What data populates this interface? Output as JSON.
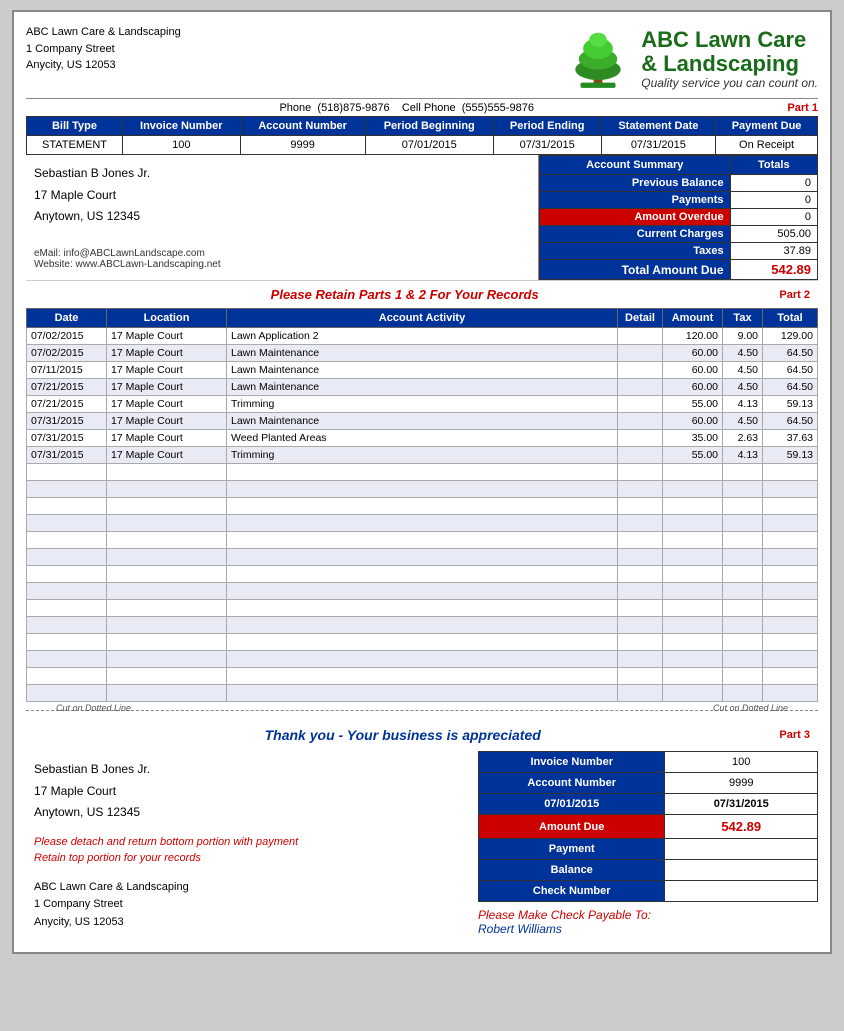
{
  "company": {
    "name_line1": "ABC Lawn Care",
    "name_line2": "& Landscaping",
    "tagline": "Quality service you can count on.",
    "address_line1": "ABC Lawn Care & Landscaping",
    "address_line2": "1 Company Street",
    "address_line3": "Anycity, US  12053"
  },
  "contact": {
    "phone_label": "Phone",
    "phone": "(518)875-9876",
    "cell_label": "Cell Phone",
    "cell": "(555)555-9876"
  },
  "part1_label": "Part 1",
  "billing_header": {
    "bill_type": "Bill Type",
    "invoice_number": "Invoice Number",
    "account_number": "Account Number",
    "period_beginning": "Period Beginning",
    "period_ending": "Period Ending",
    "statement_date": "Statement Date",
    "payment_due": "Payment Due"
  },
  "billing_data": {
    "bill_type": "STATEMENT",
    "invoice_number": "100",
    "account_number": "9999",
    "period_beginning": "07/01/2015",
    "period_ending": "07/31/2015",
    "statement_date": "07/31/2015",
    "payment_due": "On Receipt"
  },
  "customer": {
    "name": "Sebastian B Jones Jr.",
    "address1": "17 Maple Court",
    "address2": "Anytown, US  12345"
  },
  "account_summary": {
    "title": "Account Summary",
    "totals": "Totals",
    "previous_balance": "Previous Balance",
    "payments": "Payments",
    "amount_overdue": "Amount Overdue",
    "current_charges": "Current Charges",
    "taxes": "Taxes",
    "total_amount_due": "Total Amount Due",
    "prev_balance_val": "0",
    "payments_val": "0",
    "overdue_val": "0",
    "current_charges_val": "505.00",
    "taxes_val": "37.89",
    "total_val": "542.89"
  },
  "contact_info": {
    "email_label": "eMail:",
    "email": "info@ABCLawnLandscape.com",
    "website_label": "Website:",
    "website": "www.ABCLawn-Landscaping.net"
  },
  "retain_notice": "Please Retain Parts 1 & 2 For Your Records",
  "part2_label": "Part 2",
  "activity_header": {
    "date": "Date",
    "location": "Location",
    "account_activity": "Account Activity",
    "detail": "Detail",
    "amount": "Amount",
    "tax": "Tax",
    "total": "Total"
  },
  "activity_rows": [
    {
      "date": "07/02/2015",
      "location": "17 Maple Court",
      "activity": "Lawn Application 2",
      "detail": "",
      "amount": "120.00",
      "tax": "9.00",
      "total": "129.00"
    },
    {
      "date": "07/02/2015",
      "location": "17 Maple Court",
      "activity": "Lawn Maintenance",
      "detail": "",
      "amount": "60.00",
      "tax": "4.50",
      "total": "64.50"
    },
    {
      "date": "07/11/2015",
      "location": "17 Maple Court",
      "activity": "Lawn Maintenance",
      "detail": "",
      "amount": "60.00",
      "tax": "4.50",
      "total": "64.50"
    },
    {
      "date": "07/21/2015",
      "location": "17 Maple Court",
      "activity": "Lawn Maintenance",
      "detail": "",
      "amount": "60.00",
      "tax": "4.50",
      "total": "64.50"
    },
    {
      "date": "07/21/2015",
      "location": "17 Maple Court",
      "activity": "Trimming",
      "detail": "",
      "amount": "55.00",
      "tax": "4.13",
      "total": "59.13"
    },
    {
      "date": "07/31/2015",
      "location": "17 Maple Court",
      "activity": "Lawn Maintenance",
      "detail": "",
      "amount": "60.00",
      "tax": "4.50",
      "total": "64.50"
    },
    {
      "date": "07/31/2015",
      "location": "17 Maple Court",
      "activity": "Weed Planted Areas",
      "detail": "",
      "amount": "35.00",
      "tax": "2.63",
      "total": "37.63"
    },
    {
      "date": "07/31/2015",
      "location": "17 Maple Court",
      "activity": "Trimming",
      "detail": "",
      "amount": "55.00",
      "tax": "4.13",
      "total": "59.13"
    }
  ],
  "cut_left": "Cut on Dotted Line",
  "cut_right": "Cut on Dotted Line",
  "thank_you": "Thank you - Your business is appreciated",
  "part3_label": "Part 3",
  "bottom_customer": {
    "name": "Sebastian B Jones Jr.",
    "address1": "17 Maple Court",
    "address2": "Anytown, US  12345"
  },
  "detach_notice": {
    "line1": "Please detach and return bottom portion with payment",
    "line2": "Retain top portion for your records"
  },
  "bottom_company": {
    "name": "ABC Lawn Care & Landscaping",
    "address1": "1 Company Street",
    "address2": "Anycity, US  12053"
  },
  "payment_table": {
    "invoice_number_label": "Invoice Number",
    "invoice_number_val": "100",
    "account_number_label": "Account Number",
    "account_number_val": "9999",
    "date_start": "07/01/2015",
    "date_end": "07/31/2015",
    "amount_due_label": "Amount Due",
    "amount_due_val": "542.89",
    "payment_label": "Payment",
    "payment_val": "",
    "balance_label": "Balance",
    "balance_val": "",
    "check_number_label": "Check Number",
    "check_number_val": ""
  },
  "payable_notice": {
    "line1": "Please Make Check Payable To:",
    "line2": "Robert Williams"
  }
}
